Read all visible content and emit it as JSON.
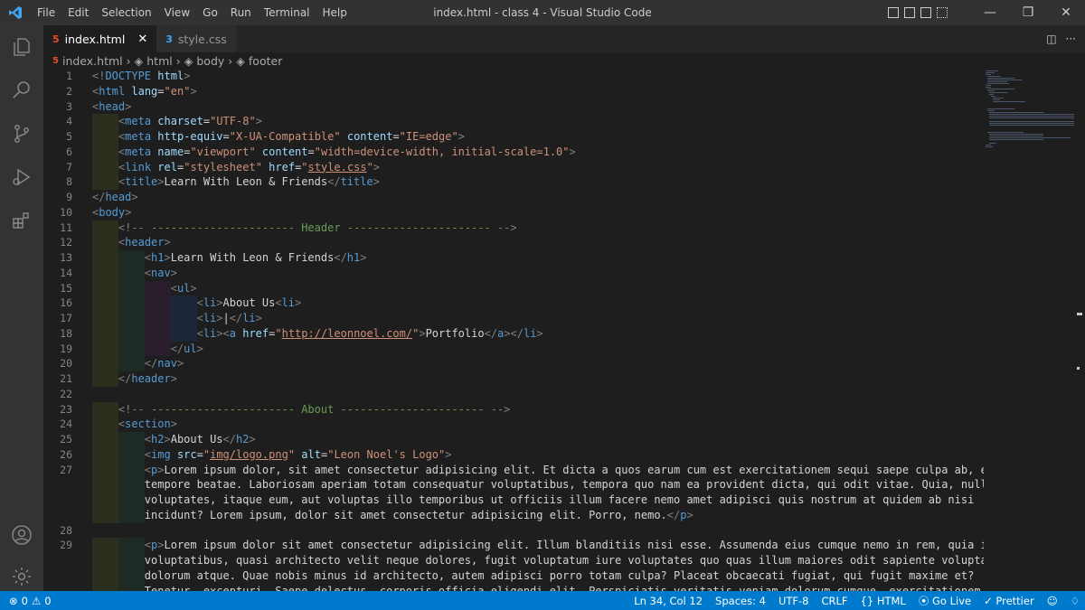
{
  "titlebar": {
    "menu": [
      "File",
      "Edit",
      "Selection",
      "View",
      "Go",
      "Run",
      "Terminal",
      "Help"
    ],
    "title": "index.html - class 4 - Visual Studio Code"
  },
  "tabs": [
    {
      "label": "index.html",
      "icon": "html5-icon",
      "active": true
    },
    {
      "label": "style.css",
      "icon": "css3-icon",
      "active": false
    }
  ],
  "breadcrumbs": [
    "index.html",
    "html",
    "body",
    "footer"
  ],
  "editor": {
    "line_numbers": [
      "1",
      "2",
      "3",
      "4",
      "5",
      "6",
      "7",
      "8",
      "9",
      "10",
      "11",
      "12",
      "13",
      "14",
      "15",
      "16",
      "17",
      "18",
      "19",
      "20",
      "21",
      "22",
      "23",
      "24",
      "25",
      "26",
      "27",
      "",
      "",
      "",
      "28",
      "29",
      "",
      "",
      ""
    ],
    "lines": [
      "<!DOCTYPE html>",
      "<html lang=\"en\">",
      "<head>",
      "    <meta charset=\"UTF-8\">",
      "    <meta http-equiv=\"X-UA-Compatible\" content=\"IE=edge\">",
      "    <meta name=\"viewport\" content=\"width=device-width, initial-scale=1.0\">",
      "    <link rel=\"stylesheet\" href=\"style.css\">",
      "    <title>Learn With Leon & Friends</title>",
      "</head>",
      "<body>",
      "    <!-- ---------------------- Header ---------------------- -->",
      "    <header>",
      "        <h1>Learn With Leon & Friends</h1>",
      "        <nav>",
      "            <ul>",
      "                <li>About Us<li>",
      "                <li>|</li>",
      "                <li><a href=\"http://leonnoel.com/\">Portfolio</a></li>",
      "            </ul>",
      "        </nav>",
      "    </header>",
      "",
      "    <!-- ---------------------- About ---------------------- -->",
      "    <section>",
      "        <h2>About Us</h2>",
      "        <img src=\"img/logo.png\" alt=\"Leon Noel's Logo\">",
      "        <p>Lorem ipsum dolor, sit amet consectetur adipisicing elit. Et dicta a quos earum cum est exercitationem sequi saepe culpa ab, esse",
      "        tempore beatae. Laboriosam aperiam totam consequatur voluptatibus, tempora quo nam ea provident dicta, qui odit vitae. Quia, nulla",
      "        voluptates, itaque eum, aut voluptas illo temporibus ut officiis illum facere nemo amet adipisci quis nostrum at quidem ab nisi",
      "        incidunt? Lorem ipsum, dolor sit amet consectetur adipisicing elit. Porro, nemo.</p>",
      "",
      "        <p>Lorem ipsum dolor sit amet consectetur adipisicing elit. Illum blanditiis nisi esse. Assumenda eius cumque nemo in rem, quia illo",
      "        voluptatibus, quasi architecto velit neque dolores, fugit voluptatum iure voluptates quo quas illum maiores odit sapiente voluptas",
      "        dolorum atque. Quae nobis minus id architecto, autem adipisci porro totam culpa? Placeat obcaecati fugiat, qui fugit maxime et?",
      "        Tenetur, excepturi. Saepe delectus, corporis officia eligendi elit. Perspiciatis veritatis veniam dolorum cumque, exercitationem amet </"
    ]
  },
  "statusbar": {
    "errors": "0",
    "warnings": "0",
    "position": "Ln 34, Col 12",
    "spaces": "Spaces: 4",
    "encoding": "UTF-8",
    "eol": "CRLF",
    "language": "HTML",
    "golive": "Go Live",
    "prettier": "Prettier"
  },
  "colors": {
    "accent": "#007acc",
    "titlebar": "#323233",
    "activitybar": "#333333",
    "editor_bg": "#1e1e1e",
    "html_icon": "#e44d26",
    "css_icon": "#42a5f5"
  }
}
